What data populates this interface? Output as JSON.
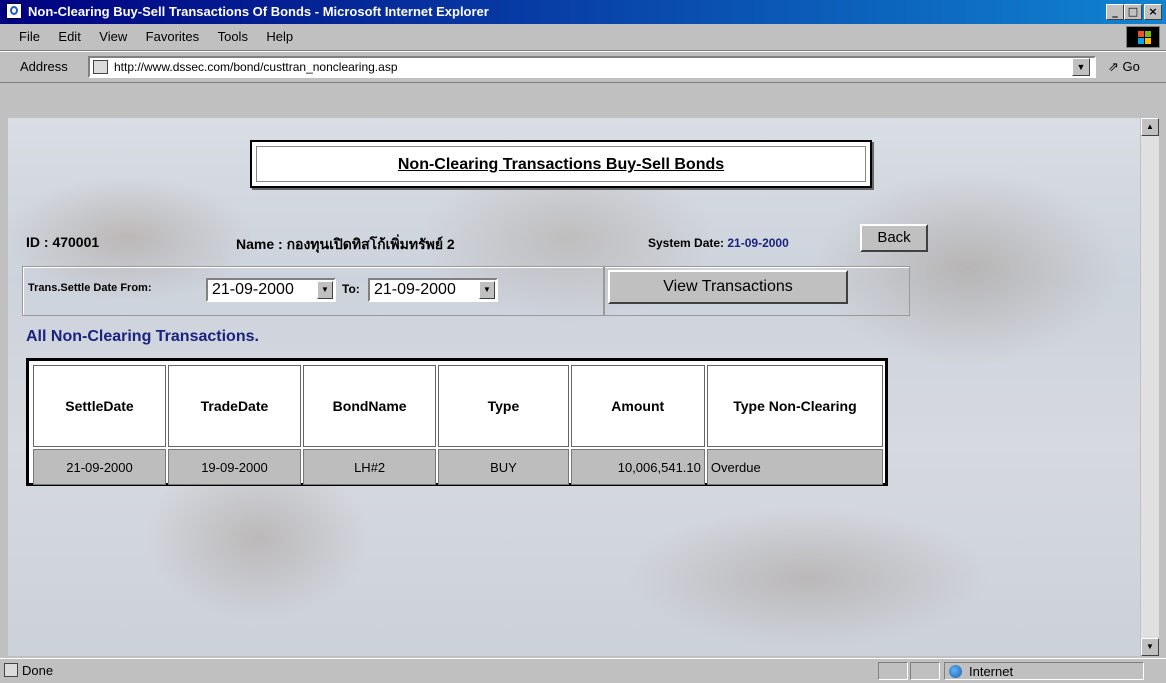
{
  "window": {
    "title": "Non-Clearing Buy-Sell Transactions Of Bonds - Microsoft Internet Explorer",
    "minimize": "_",
    "maximize": "□",
    "close": "×"
  },
  "menu": [
    "File",
    "Edit",
    "View",
    "Favorites",
    "Tools",
    "Help"
  ],
  "address": {
    "label": "Address",
    "url": "http://www.dssec.com/bond/custtran_nonclearing.asp",
    "go_label": "Go",
    "go_symbol": "⇗"
  },
  "page": {
    "heading": "Non-Clearing Transactions Buy-Sell Bonds",
    "id_text": "ID : 470001",
    "name_text": "Name : กองทุนเปิดทิสโก้เพิ่มทรัพย์ 2",
    "system_date_label": "System Date: ",
    "system_date_value": "21-09-2000",
    "back_label": "Back",
    "filter": {
      "from_label": "Trans.Settle Date From:",
      "from_value": "21-09-2000",
      "to_label": "To:",
      "to_value": "21-09-2000",
      "view_label": "View Transactions"
    },
    "section_title": "All Non-Clearing Transactions."
  },
  "table": {
    "headers": [
      "SettleDate",
      "TradeDate",
      "BondName",
      "Type",
      "Amount",
      "Type Non-Clearing"
    ],
    "rows": [
      [
        "21-09-2000",
        "19-09-2000",
        "LH#2",
        "BUY",
        "10,006,541.10",
        "Overdue"
      ]
    ]
  },
  "status": {
    "text": "Done",
    "zone": "Internet"
  },
  "colors": {
    "title_bar": "#000080",
    "link_blue": "#1a237e"
  }
}
